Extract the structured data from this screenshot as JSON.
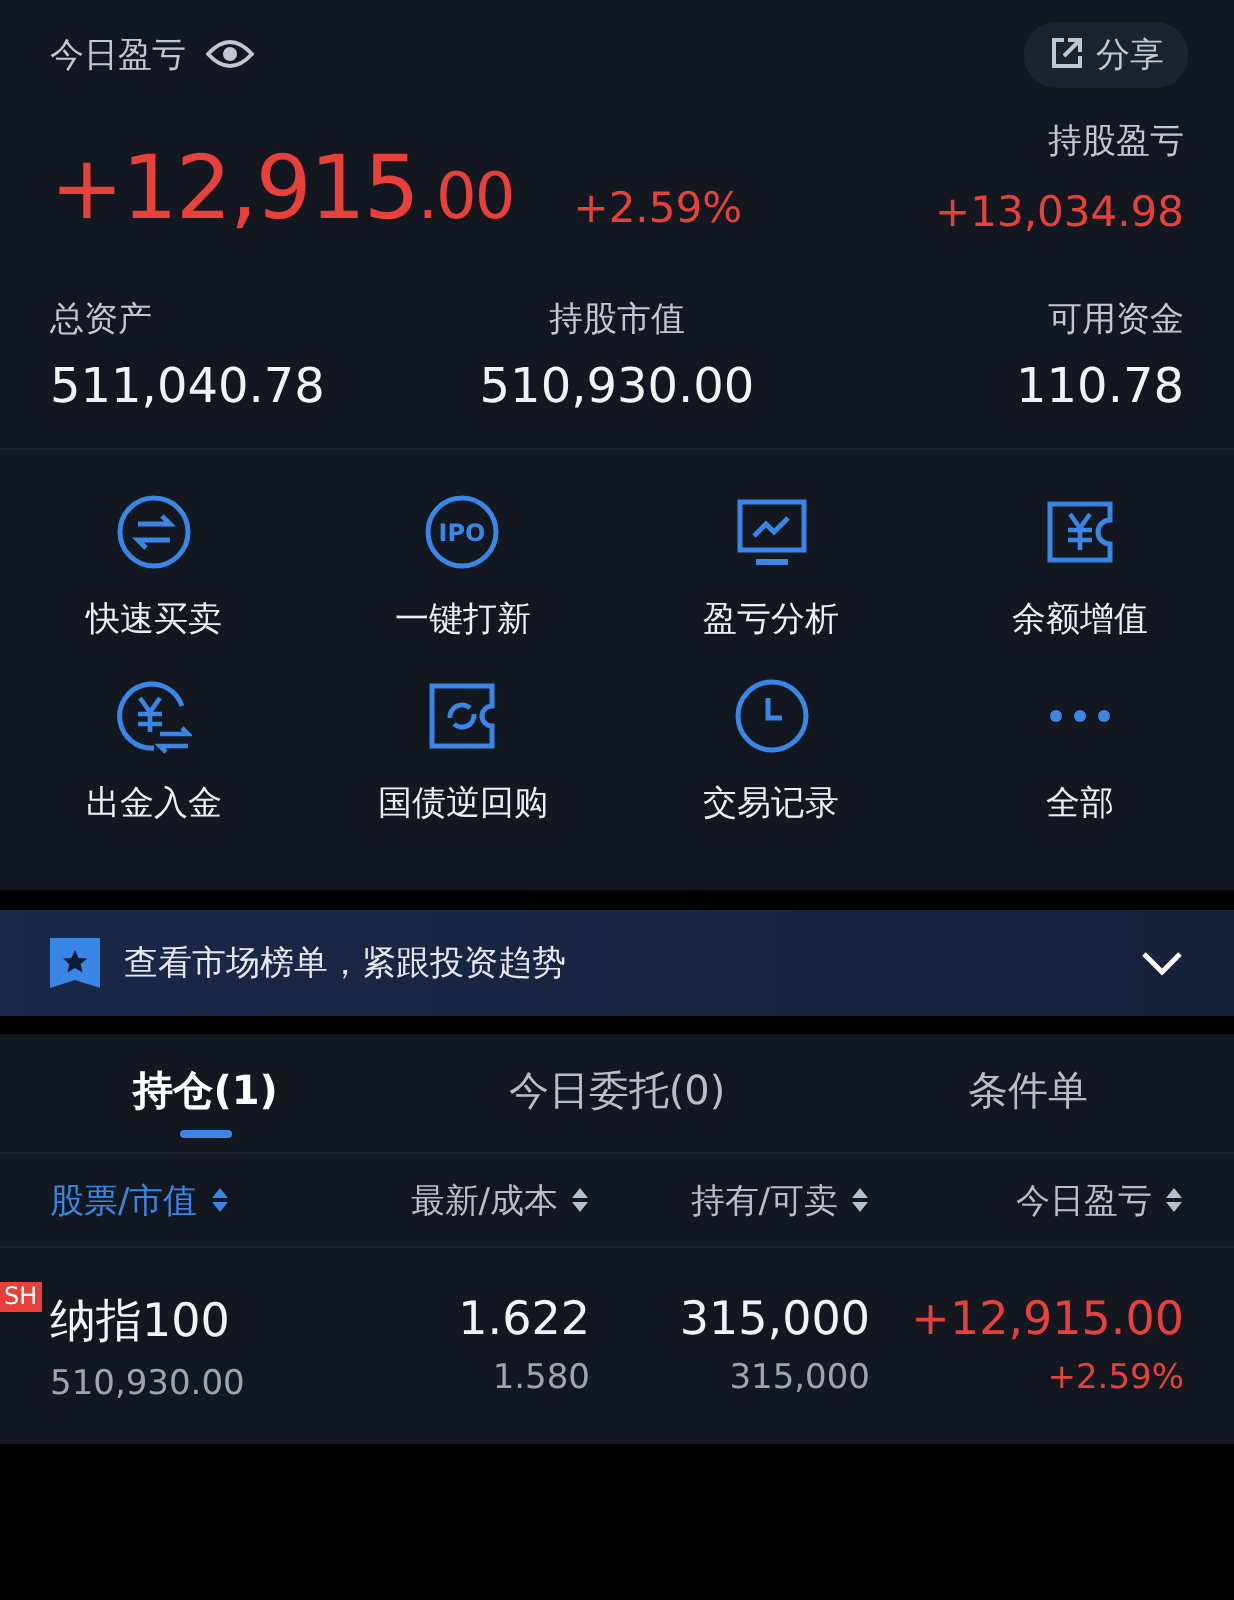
{
  "summary": {
    "title": "今日盈亏",
    "share_button": "分享",
    "today_pl": "+12,915.00",
    "today_pct": "+2.59%",
    "holding_pl_label": "持股盈亏",
    "holding_pl": "+13,034.98",
    "stats": [
      {
        "label": "总资产",
        "value": "511,040.78"
      },
      {
        "label": "持股市值",
        "value": "510,930.00"
      },
      {
        "label": "可用资金",
        "value": "110.78"
      }
    ]
  },
  "quick_actions": [
    {
      "label": "快速买卖"
    },
    {
      "label": "一键打新",
      "icon_text": "IPO"
    },
    {
      "label": "盈亏分析"
    },
    {
      "label": "余额增值"
    },
    {
      "label": "出金入金"
    },
    {
      "label": "国债逆回购"
    },
    {
      "label": "交易记录"
    },
    {
      "label": "全部"
    }
  ],
  "banner": {
    "text": "查看市场榜单，紧跟投资趋势"
  },
  "tabs": [
    {
      "label": "持仓(1)",
      "selected": true
    },
    {
      "label": "今日委托(0)",
      "selected": false
    },
    {
      "label": "条件单",
      "selected": false
    }
  ],
  "table": {
    "columns": [
      {
        "label": "股票/市值",
        "selected": true
      },
      {
        "label": "最新/成本",
        "selected": false
      },
      {
        "label": "持有/可卖",
        "selected": false
      },
      {
        "label": "今日盈亏",
        "selected": false
      }
    ],
    "rows": [
      {
        "market": "SH",
        "name": "纳指100",
        "market_value": "510,930.00",
        "latest": "1.622",
        "cost": "1.580",
        "held": "315,000",
        "sellable": "315,000",
        "pl": "+12,915.00",
        "pl_pct": "+2.59%"
      }
    ]
  }
}
